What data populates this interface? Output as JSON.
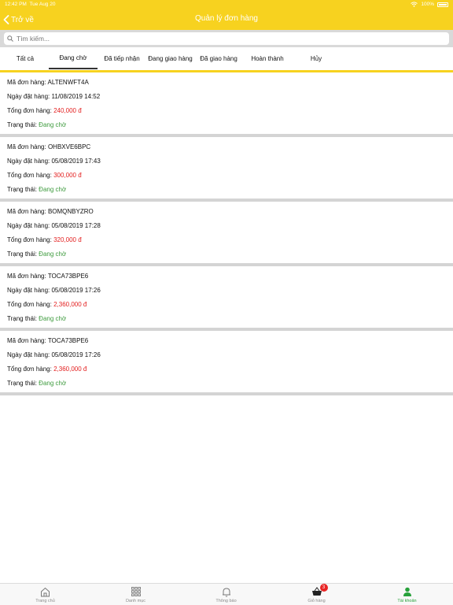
{
  "status_bar": {
    "time": "12:42 PM",
    "date": "Tue Aug 20",
    "battery": "100%"
  },
  "header": {
    "back_label": "Trở về",
    "title": "Quản lý đơn hàng",
    "color": "#f7d21f"
  },
  "search": {
    "placeholder": "Tìm kiếm..."
  },
  "tabs": [
    {
      "label": "Tất cả"
    },
    {
      "label": "Đang chờ",
      "active": true
    },
    {
      "label": "Đã tiếp nhận"
    },
    {
      "label": "Đang giao hàng"
    },
    {
      "label": "Đã giao hàng"
    },
    {
      "label": "Hoàn thành"
    },
    {
      "label": "Hủy"
    }
  ],
  "labels": {
    "order_code": "Mã đơn hàng: ",
    "order_date": "Ngày đặt hàng: ",
    "total": "Tổng đơn hàng: ",
    "status": "Trạng thái: "
  },
  "orders": [
    {
      "code": "ALTENWFT4A",
      "date": "11/08/2019 14:52",
      "total": "240,000 đ",
      "status": "Đang chờ"
    },
    {
      "code": "OHBXVE6BPC",
      "date": "05/08/2019 17:43",
      "total": "300,000 đ",
      "status": "Đang chờ"
    },
    {
      "code": "BOMQNBYZRO",
      "date": "05/08/2019 17:28",
      "total": "320,000 đ",
      "status": "Đang chờ"
    },
    {
      "code": "TOCA73BPE6",
      "date": "05/08/2019 17:26",
      "total": "2,360,000 đ",
      "status": "Đang chờ"
    },
    {
      "code": "TOCA73BPE6",
      "date": "05/08/2019 17:26",
      "total": "2,360,000 đ",
      "status": "Đang chờ"
    }
  ],
  "tabbar": [
    {
      "label": "Trang chủ",
      "icon": "home-icon"
    },
    {
      "label": "Danh mục",
      "icon": "grid-icon"
    },
    {
      "label": "Thông báo",
      "icon": "bell-icon"
    },
    {
      "label": "Giỏ hàng",
      "icon": "basket-icon",
      "badge": "3"
    },
    {
      "label": "Tài khoản",
      "icon": "user-icon",
      "active": true
    }
  ],
  "colors": {
    "accent": "#f7d21f",
    "price": "#e32020",
    "status": "#3c9a3c",
    "active_tab": "#27a13a"
  }
}
